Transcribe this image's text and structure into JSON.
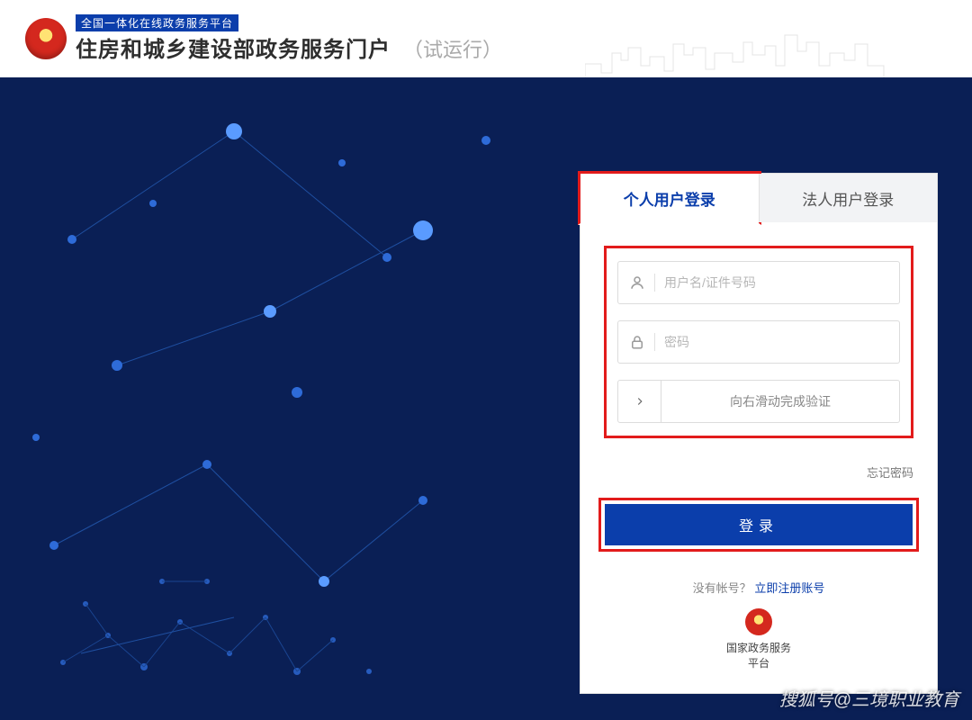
{
  "header": {
    "badge": "全国一体化在线政务服务平台",
    "title": "住房和城乡建设部政务服务门户",
    "trial": "（试运行）"
  },
  "login": {
    "tabs": {
      "personal": "个人用户登录",
      "corporate": "法人用户登录"
    },
    "username_placeholder": "用户名/证件号码",
    "password_placeholder": "密码",
    "slider_text": "向右滑动完成验证",
    "forgot": "忘记密码",
    "submit": "登录",
    "no_account": "没有帐号？",
    "register": "立即注册账号",
    "gov_platform_line1": "国家政务服务",
    "gov_platform_line2": "平台"
  },
  "watermark": "搜狐号@三境职业教育"
}
